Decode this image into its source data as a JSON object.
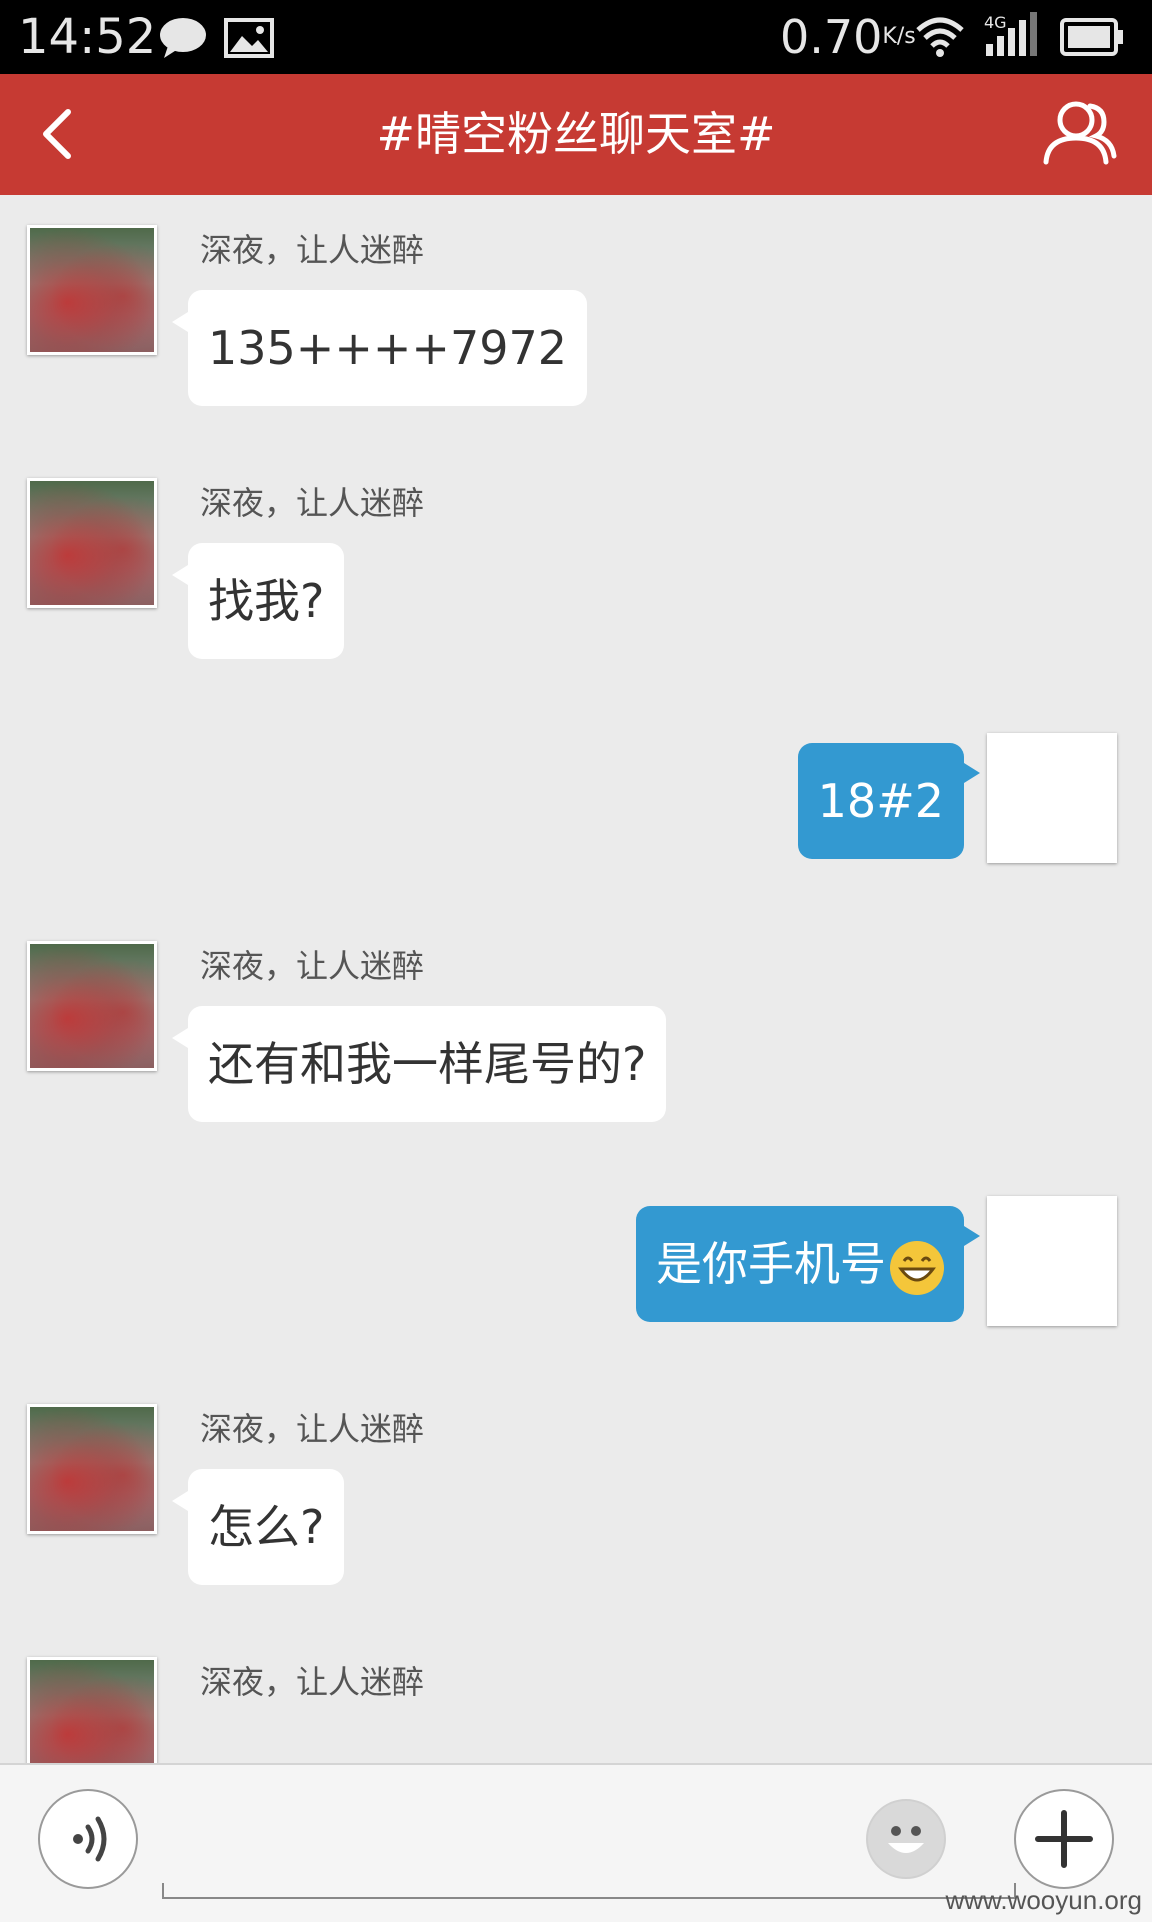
{
  "status_bar": {
    "time": "14:52",
    "speed": "0.70",
    "speed_unit": "K/s",
    "network": "4G",
    "icons": [
      "message-icon",
      "image-icon",
      "wifi-icon",
      "signal-icon",
      "battery-icon"
    ]
  },
  "header": {
    "title": "#晴空粉丝聊天室#",
    "back_icon": "chevron-left-icon",
    "members_icon": "group-icon"
  },
  "messages": [
    {
      "direction": "incoming",
      "sender": "深夜，让人迷醉",
      "text": "135++++7972"
    },
    {
      "direction": "incoming",
      "sender": "深夜，让人迷醉",
      "text": "找我?"
    },
    {
      "direction": "outgoing",
      "text": "18#2"
    },
    {
      "direction": "incoming",
      "sender": "深夜，让人迷醉",
      "text": "还有和我一样尾号的?"
    },
    {
      "direction": "outgoing",
      "text": "是你手机号",
      "emoji": "grinning-face-icon"
    },
    {
      "direction": "incoming",
      "sender": "深夜，让人迷醉",
      "text": "怎么?"
    },
    {
      "direction": "incoming",
      "sender": "深夜，让人迷醉",
      "text": ""
    }
  ],
  "input_bar": {
    "voice_icon": "voice-icon",
    "emoji_icon": "smiley-icon",
    "add_icon": "plus-icon"
  },
  "watermark": "www.wooyun.org",
  "colors": {
    "header": "#c63a33",
    "outgoing_bubble": "#3399d1",
    "incoming_bubble": "#ffffff",
    "chat_background": "#ebebeb"
  }
}
